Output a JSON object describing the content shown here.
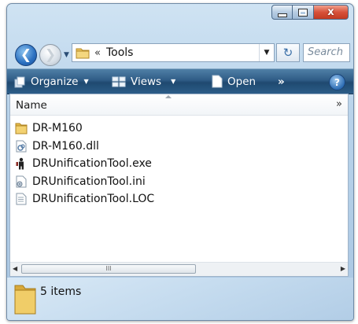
{
  "window": {
    "caption_buttons": {
      "minimize": "minimize-icon",
      "maximize": "maximize-icon",
      "close": "x"
    }
  },
  "navigation": {
    "back_icon": "back-arrow-icon",
    "forward_icon": "forward-arrow-icon",
    "address_prefix": "«",
    "address_path": "Tools",
    "refresh_glyph": "↻",
    "search_placeholder": "Search"
  },
  "command_bar": {
    "organize_label": "Organize",
    "views_label": "Views",
    "open_label": "Open",
    "overflow_label": "»",
    "help_label": "?",
    "color": "#2f5c86"
  },
  "columns": {
    "name_header": "Name",
    "more_label": "»"
  },
  "files": [
    {
      "name": "DR-M160",
      "icon": "folder-icon"
    },
    {
      "name": "DR-M160.dll",
      "icon": "dll-file-icon"
    },
    {
      "name": "DRUnificationTool.exe",
      "icon": "exe-app-icon"
    },
    {
      "name": "DRUnificationTool.ini",
      "icon": "ini-settings-icon"
    },
    {
      "name": "DRUnificationTool.LOC",
      "icon": "text-file-icon"
    }
  ],
  "scrollbar": {
    "grip": "III"
  },
  "details": {
    "item_count": "5 items"
  }
}
